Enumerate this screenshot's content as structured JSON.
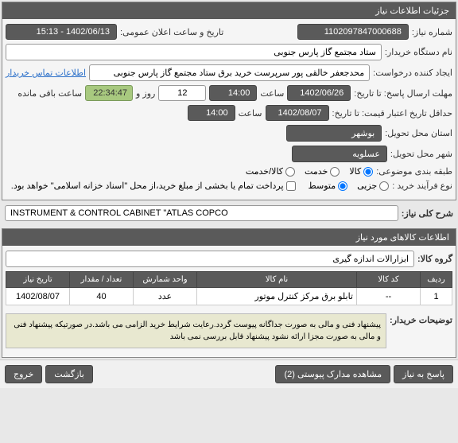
{
  "panel1": {
    "title": "جزئیات اطلاعات نیاز",
    "need_number_label": "شماره نیاز:",
    "need_number": "1102097847000688",
    "announce_label": "تاریخ و ساعت اعلان عمومی:",
    "announce_value": "1402/06/13 - 15:13",
    "buyer_label": "نام دستگاه خریدار:",
    "buyer_value": "ستاد مجتمع گاز پارس جنوبی",
    "requester_label": "ایجاد کننده درخواست:",
    "requester_value": "محدجعفر خالقی پور سرپرست خرید برق ستاد مجتمع گاز پارس جنوبی",
    "contact_link": "اطلاعات تماس خریدار",
    "deadline_label": "مهلت ارسال پاسخ: تا تاریخ:",
    "deadline_date": "1402/06/26",
    "time_label": "ساعت",
    "deadline_time": "14:00",
    "days_value": "12",
    "days_label": "روز و",
    "countdown": "22:34:47",
    "remain_label": "ساعت باقی مانده",
    "validity_label": "حداقل تاریخ اعتبار قیمت: تا تاریخ:",
    "validity_date": "1402/08/07",
    "validity_time": "14:00",
    "province_label": "استان محل تحویل:",
    "province_value": "بوشهر",
    "city_label": "شهر محل تحویل:",
    "city_value": "عسلویه",
    "category_label": "طبقه بندی موضوعی:",
    "cat_kala": "کالا",
    "cat_service": "خدمت",
    "cat_both": "کالا/خدمت",
    "process_label": "نوع فرآیند خرید :",
    "proc_partial": "جزیی",
    "proc_medium": "متوسط",
    "payment_note": "پرداخت تمام یا بخشی از مبلغ خرید،از محل \"اسناد خزانه اسلامی\" خواهد بود."
  },
  "desc": {
    "label": "شرح کلی نیاز:",
    "value": "INSTRUMENT & CONTROL CABINET \"ATLAS COPCO"
  },
  "panel2": {
    "title": "اطلاعات کالاهای مورد نیاز",
    "group_label": "گروه کالا:",
    "group_value": "ابزارالات اندازه گیری",
    "table": {
      "headers": [
        "ردیف",
        "کد کالا",
        "نام کالا",
        "واحد شمارش",
        "تعداد / مقدار",
        "تاریخ نیاز"
      ],
      "rows": [
        [
          "1",
          "--",
          "تابلو برق مرکز کنترل موتور",
          "عدد",
          "40",
          "1402/08/07"
        ]
      ]
    },
    "buyer_note_label": "توضیحات خریدار:",
    "buyer_note": "پیشنهاد فنی و مالی به صورت جداگانه پیوست گردد.رعایت شرایط خرید الزامی می باشد.در صورتیکه پیشنهاد فنی و مالی به صورت مجزا ارائه نشود پیشنهاد قابل بررسی نمی باشد"
  },
  "footer": {
    "respond": "پاسخ به نیاز",
    "attachments": "مشاهده مدارک پیوستی (2)",
    "back": "بازگشت",
    "exit": "خروج"
  }
}
